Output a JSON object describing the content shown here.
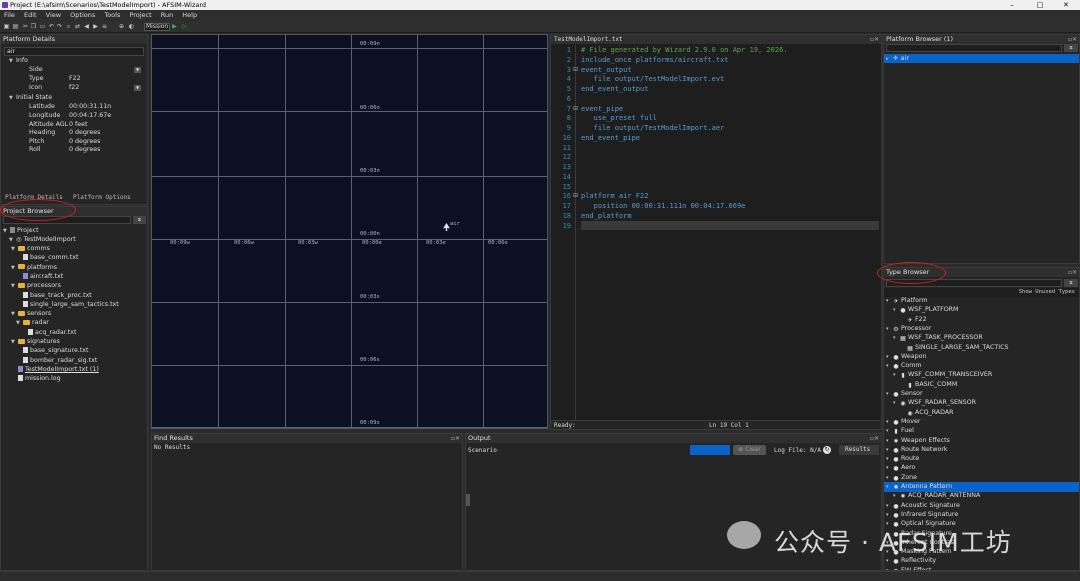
{
  "window": {
    "title": "Project (E:\\afsim\\Scenarios\\TestModelImport) - AFSIM-Wizard",
    "min": "–",
    "max": "□",
    "close": "✕"
  },
  "menu": [
    "File",
    "Edit",
    "View",
    "Options",
    "Tools",
    "Project",
    "Run",
    "Help"
  ],
  "toolbar": {
    "mission_label": "Mission"
  },
  "platform_details": {
    "title": "Platform Details",
    "selected": "air",
    "info_header": "Info",
    "info": [
      {
        "label": "Side",
        "value": ""
      },
      {
        "label": "Type",
        "value": "F22"
      },
      {
        "label": "Icon",
        "value": "f22"
      }
    ],
    "state_header": "Initial State",
    "state": [
      {
        "label": "Latitude",
        "value": "00:00:31.11n"
      },
      {
        "label": "Longitude",
        "value": "00:04:17.67e"
      },
      {
        "label": "Altitude AGL",
        "value": "0 feet"
      },
      {
        "label": "Heading",
        "value": "0 degrees"
      },
      {
        "label": "Pitch",
        "value": "0 degrees"
      },
      {
        "label": "Roll",
        "value": "0 degrees"
      }
    ],
    "tabs": [
      "Platform Details",
      "Platform Options"
    ]
  },
  "project_browser": {
    "title": "Project Browser",
    "root": "Project",
    "project_name": "TestModelImport",
    "items": [
      {
        "kind": "folder",
        "label": "comms",
        "indent": 2
      },
      {
        "kind": "file",
        "label": "base_comm.txt",
        "indent": 3
      },
      {
        "kind": "folder",
        "label": "platforms",
        "indent": 2
      },
      {
        "kind": "fileb",
        "label": "aircraft.txt",
        "indent": 3
      },
      {
        "kind": "folder",
        "label": "processors",
        "indent": 2
      },
      {
        "kind": "file",
        "label": "base_track_proc.txt",
        "indent": 3
      },
      {
        "kind": "file",
        "label": "single_large_sam_tactics.txt",
        "indent": 3
      },
      {
        "kind": "folder",
        "label": "sensors",
        "indent": 2
      },
      {
        "kind": "folder",
        "label": "radar",
        "indent": 3
      },
      {
        "kind": "file",
        "label": "acq_radar.txt",
        "indent": 4
      },
      {
        "kind": "folder",
        "label": "signatures",
        "indent": 2
      },
      {
        "kind": "file",
        "label": "base_signature.txt",
        "indent": 3
      },
      {
        "kind": "file",
        "label": "bomber_radar_sig.txt",
        "indent": 3
      },
      {
        "kind": "fileb",
        "label": "TestModelImport.txt (1)",
        "indent": 2
      },
      {
        "kind": "file",
        "label": "mission.log",
        "indent": 2
      }
    ]
  },
  "map": {
    "labels_top": [
      "00:09n",
      "00:06n",
      "00:03n",
      "00:00n",
      "00:03s",
      "00:06s",
      "00:09s"
    ],
    "labels_row": [
      "00:09w",
      "00:06w",
      "00:03w",
      "00:00e",
      "00:03e",
      "00:06e"
    ],
    "platform_label": "air"
  },
  "editor": {
    "tab": "TestModelImport.txt",
    "lines": [
      "# File generated by Wizard 2.9.0 on Apr 19, 2026.",
      "include_once platforms/aircraft.txt",
      "event_output",
      "   file output/TestModelImport.evt",
      "end_event_output",
      "",
      "event_pipe",
      "   use_preset full",
      "   file output/TestModelImport.aer",
      "end_event_pipe",
      "",
      "",
      "",
      "",
      "",
      "platform air F22",
      "   position 00:00:31.111n 00:04:17.669e",
      "end_platform",
      ""
    ],
    "status_left": "Ready:",
    "status_pos": "Ln 19 Col 1"
  },
  "find_results": {
    "title": "Find Results",
    "empty": "No Results"
  },
  "output": {
    "title": "Output",
    "scenario_label": "Scenario",
    "clear": "Clear",
    "log_file": "Log File: N/A",
    "results": "Results"
  },
  "platform_browser": {
    "title": "Platform Browser (1)",
    "item": "air"
  },
  "type_browser": {
    "title": "Type Browser",
    "show_unused": "Show Unused Types",
    "items": [
      {
        "label": "Platform",
        "indent": 0,
        "icon": "✈"
      },
      {
        "label": "WSF_PLATFORM",
        "indent": 1,
        "icon": "●"
      },
      {
        "label": "F22",
        "indent": 2,
        "icon": "✈"
      },
      {
        "label": "Processor",
        "indent": 0,
        "icon": "⚙"
      },
      {
        "label": "WSF_TASK_PROCESSOR",
        "indent": 1,
        "icon": "▦"
      },
      {
        "label": "SINGLE_LARGE_SAM_TACTICS",
        "indent": 2,
        "icon": "▦"
      },
      {
        "label": "Weapon",
        "indent": 0,
        "icon": "●"
      },
      {
        "label": "Comm",
        "indent": 0,
        "icon": "●"
      },
      {
        "label": "WSF_COMM_TRANSCEIVER",
        "indent": 1,
        "icon": "▮"
      },
      {
        "label": "BASIC_COMM",
        "indent": 2,
        "icon": "▮"
      },
      {
        "label": "Sensor",
        "indent": 0,
        "icon": "●"
      },
      {
        "label": "WSF_RADAR_SENSOR",
        "indent": 1,
        "icon": "◉"
      },
      {
        "label": "ACQ_RADAR",
        "indent": 2,
        "icon": "◉"
      },
      {
        "label": "Mover",
        "indent": 0,
        "icon": "●"
      },
      {
        "label": "Fuel",
        "indent": 0,
        "icon": "▮"
      },
      {
        "label": "Weapon Effects",
        "indent": 0,
        "icon": "✸"
      },
      {
        "label": "Route Network",
        "indent": 0,
        "icon": "●"
      },
      {
        "label": "Route",
        "indent": 0,
        "icon": "●"
      },
      {
        "label": "Aero",
        "indent": 0,
        "icon": "●"
      },
      {
        "label": "Zone",
        "indent": 0,
        "icon": "●"
      },
      {
        "label": "Antenna Pattern",
        "indent": 0,
        "icon": "✸",
        "selected": true
      },
      {
        "label": "ACQ_RADAR_ANTENNA",
        "indent": 1,
        "icon": "✸"
      },
      {
        "label": "Acoustic Signature",
        "indent": 0,
        "icon": "●"
      },
      {
        "label": "Infrared Signature",
        "indent": 0,
        "icon": "●"
      },
      {
        "label": "Optical Signature",
        "indent": 0,
        "icon": "●"
      },
      {
        "label": "Radar Signature",
        "indent": 0,
        "icon": "●"
      },
      {
        "label": "Inherent Contrast",
        "indent": 0,
        "icon": "●"
      },
      {
        "label": "Masking Pattern",
        "indent": 0,
        "icon": "●"
      },
      {
        "label": "Reflectivity",
        "indent": 0,
        "icon": "●"
      },
      {
        "label": "EW Effect",
        "indent": 0,
        "icon": "●"
      }
    ]
  },
  "watermark": "公众号 · AFSIM工坊",
  "colors": {
    "accent": "#0a64c8",
    "annotation": "#d21f1f",
    "comment": "#57a64a",
    "keyword": "#569cd6"
  }
}
